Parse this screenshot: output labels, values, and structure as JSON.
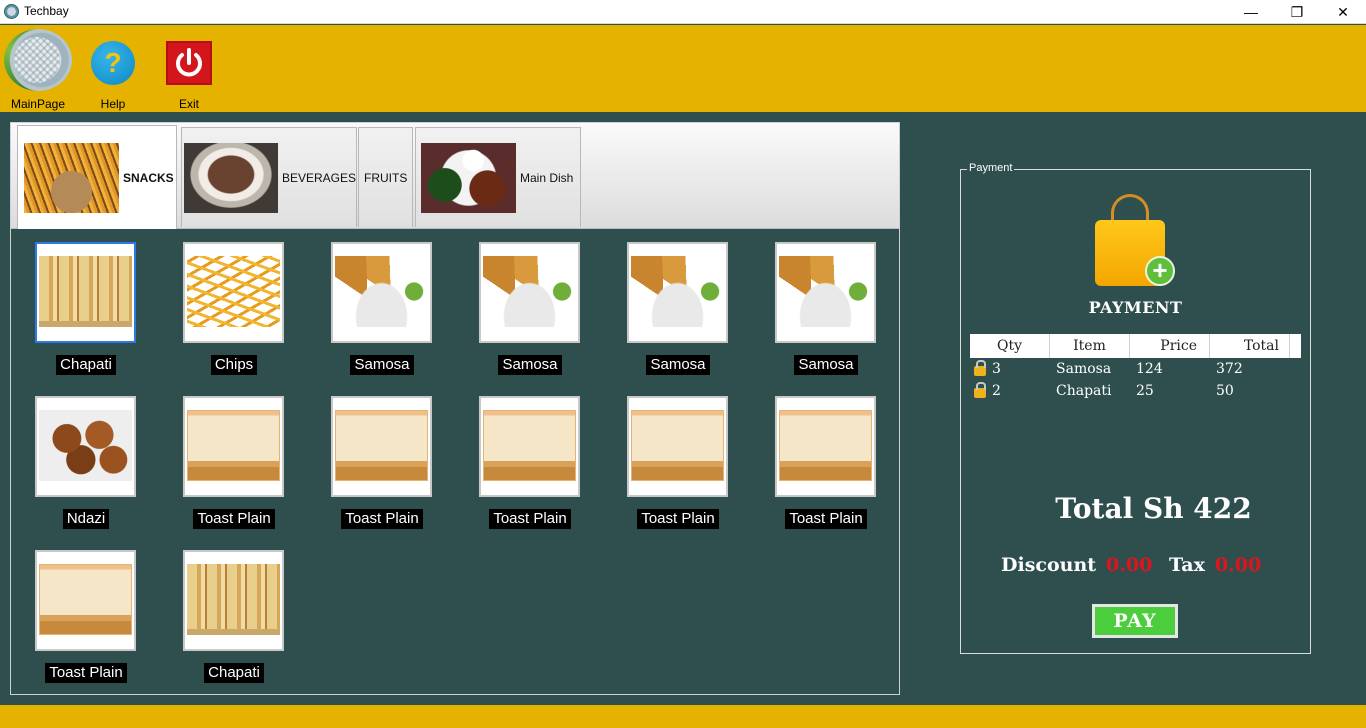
{
  "window": {
    "title": "Techbay",
    "controls": {
      "minimize": "—",
      "maximize": "❐",
      "close": "✕"
    }
  },
  "toolbar": {
    "background": "#E6B200",
    "items": [
      {
        "label": "MainPage",
        "icon": "globe-icon"
      },
      {
        "label": "Help",
        "icon": "help-icon"
      },
      {
        "label": "Exit",
        "icon": "power-icon"
      }
    ]
  },
  "tabs": [
    {
      "label": "SNACKS",
      "image": "fries-image",
      "active": true
    },
    {
      "label": "BEVERAGES",
      "image": "coffee-image",
      "active": false
    },
    {
      "label": "FRUITS",
      "active": false
    },
    {
      "label": "Main Dish",
      "image": "dish-image",
      "active": false
    }
  ],
  "products": [
    {
      "name": "Chapati",
      "image": "chapati",
      "selected": true
    },
    {
      "name": "Chips",
      "image": "chips"
    },
    {
      "name": "Samosa",
      "image": "samosa"
    },
    {
      "name": "Samosa",
      "image": "samosa"
    },
    {
      "name": "Samosa",
      "image": "samosa"
    },
    {
      "name": "Samosa",
      "image": "samosa"
    },
    {
      "name": "Ndazi",
      "image": "ndazi"
    },
    {
      "name": "Toast Plain",
      "image": "toast"
    },
    {
      "name": "Toast Plain",
      "image": "toast"
    },
    {
      "name": "Toast Plain",
      "image": "toast"
    },
    {
      "name": "Toast Plain",
      "image": "toast"
    },
    {
      "name": "Toast Plain",
      "image": "toast"
    },
    {
      "name": "Toast Plain",
      "image": "toast"
    },
    {
      "name": "Chapati",
      "image": "chapati"
    }
  ],
  "payment": {
    "legend": "Payment",
    "title": "PAYMENT",
    "icon": "shopping-bag-add-icon",
    "columns": [
      "Qty",
      "Item",
      "Price",
      "Total"
    ],
    "orders": [
      {
        "qty": "3",
        "item": "Samosa",
        "price": "124",
        "total": "372"
      },
      {
        "qty": "2",
        "item": "Chapati",
        "price": "25",
        "total": "50"
      }
    ],
    "total_text": "Total Sh 422",
    "discount_label": "Discount",
    "discount_value": "0.00",
    "tax_label": "Tax",
    "tax_value": "0.00",
    "pay_label": "PAY",
    "accent_red": "#E0141C",
    "pay_green": "#4CCD3C"
  },
  "colors": {
    "background": "#2F4F4F",
    "toolbar": "#E6B200"
  }
}
